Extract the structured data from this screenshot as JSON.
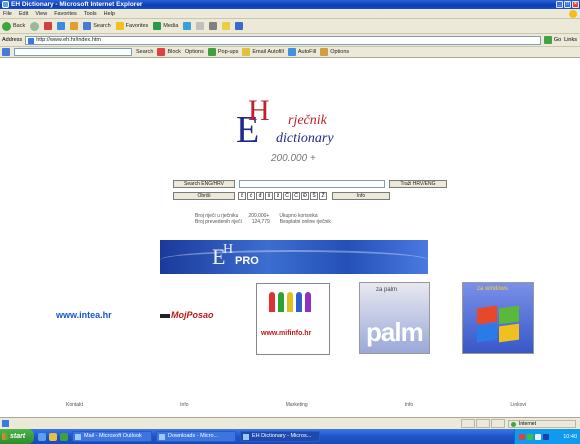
{
  "window": {
    "title": "EH Dictionary - Microsoft Internet Explorer"
  },
  "menubar": {
    "items": [
      "File",
      "Edit",
      "View",
      "Favorites",
      "Tools",
      "Help"
    ]
  },
  "toolbar": {
    "back_label": "Back",
    "search_label": "Search",
    "favorites_label": "Favorites",
    "media_label": "Media"
  },
  "addressbar": {
    "label": "Address",
    "url": "http://www.eh.hr/index.htm",
    "go_label": "Go",
    "links_label": "Links"
  },
  "linksbar": {
    "items": [
      "Search",
      "Block",
      "Options",
      "Pop-ups",
      "Email Autofill",
      "AutoFill",
      "Options"
    ]
  },
  "logo": {
    "E": "E",
    "H": "H",
    "hr_word": "rječnik",
    "en_word": "dictionary",
    "count": "200.000 +"
  },
  "search": {
    "left_button": "Search ENG/HRV",
    "right_button": "Traži HRV/ENG",
    "clear_button": "Obriši",
    "info_button": "Info",
    "letters": [
      "č",
      "ć",
      "đ",
      "š",
      "ž",
      "Č",
      "Ć",
      "Đ",
      "Š",
      "Ž"
    ]
  },
  "stats": {
    "line1_label": "Broj riječi u rječniku",
    "line1_value": "200.000+",
    "line1_extra": "Ukupno korisnika",
    "line2_label": "Broj prevedenih riječi",
    "line2_value": "124,779",
    "line2_extra": "Besplatni online rječnik"
  },
  "banner": {
    "E": "E",
    "H": "H",
    "pro": "PRO"
  },
  "ads": {
    "intea": "www.intea.hr",
    "mojposao": "MojPosao",
    "mif": "www.mifinfo.hr",
    "palm_top": "za palm",
    "palm": "palm",
    "windows_top": "za windows"
  },
  "footer": {
    "links": [
      "Kontakt",
      "Info",
      "Marketing",
      "Info",
      "Linkovi"
    ]
  },
  "statusbar": {
    "zone": "Internet"
  },
  "taskbar": {
    "start": "start",
    "tasks": [
      "Mail - Microsoft Outlook",
      "Downloads - Micro...",
      "EH Dictionary - Micros..."
    ],
    "clock": "10:40"
  }
}
